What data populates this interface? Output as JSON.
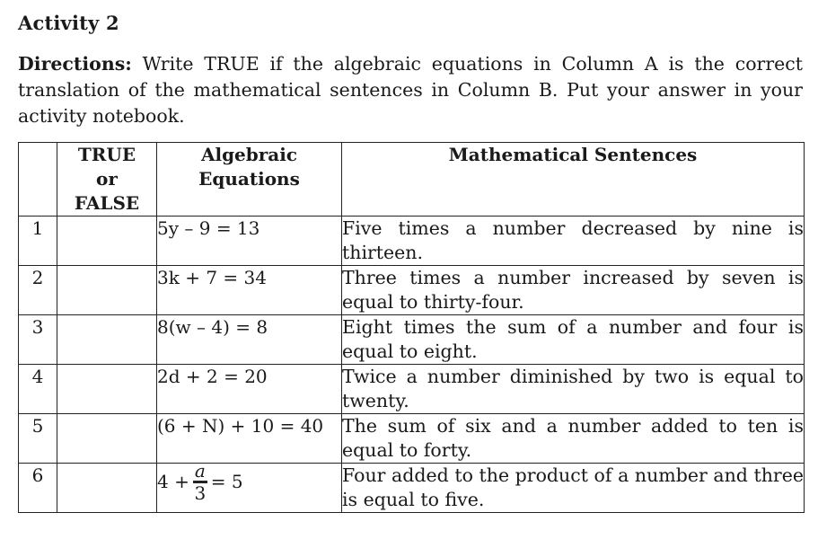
{
  "title": "Activity 2",
  "directions": {
    "label": "Directions:",
    "text": " Write TRUE if the algebraic equations in Column A is the correct translation of the mathematical sentences in Column B. Put your answer in your activity notebook."
  },
  "table": {
    "headers": {
      "number": "",
      "true_false": "TRUE or FALSE",
      "true_false_lines": [
        "TRUE",
        "or",
        "FALSE"
      ],
      "equations_lines": [
        "Algebraic",
        "Equations"
      ],
      "sentences": "Mathematical Sentences"
    },
    "rows": [
      {
        "number": "1",
        "answer": "",
        "equation": "5y – 9 = 13",
        "sentence": "Five times a number decreased by nine is thirteen."
      },
      {
        "number": "2",
        "answer": "",
        "equation": "3k + 7 = 34",
        "sentence": "Three times a number increased by seven is equal to thirty-four."
      },
      {
        "number": "3",
        "answer": "",
        "equation": "8(w – 4) = 8",
        "sentence": "Eight times the sum of a number and four is equal to eight."
      },
      {
        "number": "4",
        "answer": "",
        "equation": "2d + 2 = 20",
        "sentence": "Twice a number diminished by two is equal to twenty."
      },
      {
        "number": "5",
        "answer": "",
        "equation": "(6 + N) + 10 = 40",
        "sentence": "The sum of six and a number added to ten is equal to forty."
      },
      {
        "number": "6",
        "answer": "",
        "equation_parts": {
          "prefix": "4 +",
          "numerator": "a",
          "denominator": "3",
          "suffix": "= 5"
        },
        "sentence": "Four added to the product of a number and three is equal to five."
      }
    ]
  }
}
